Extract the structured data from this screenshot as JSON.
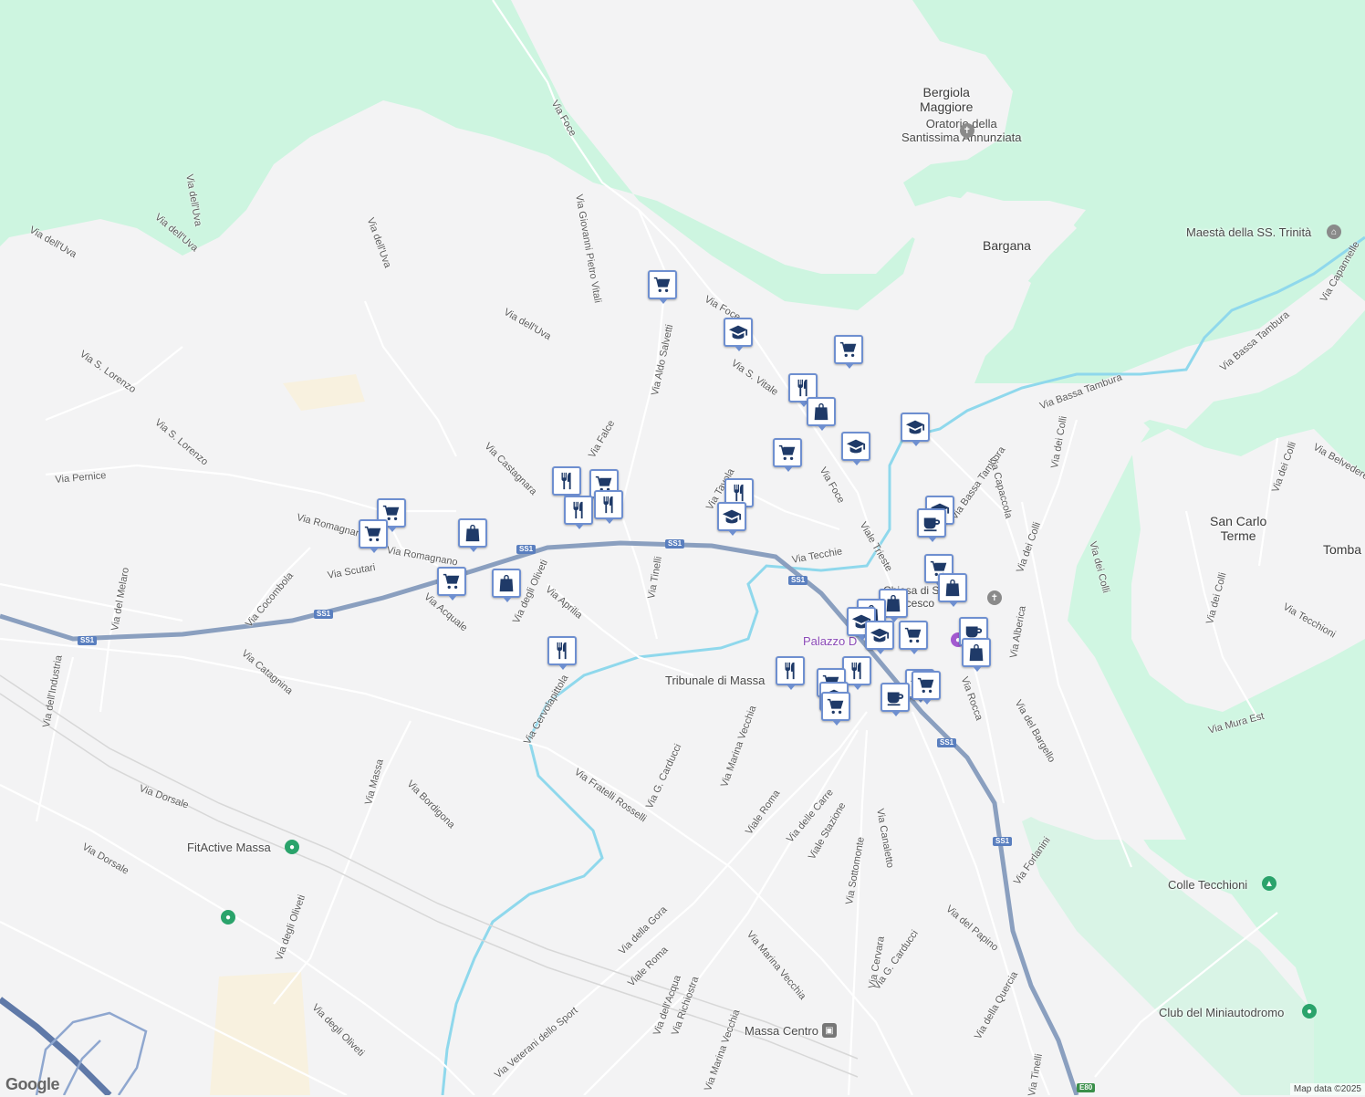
{
  "places": {
    "bergiola": "Bergiola\nMaggiore",
    "bargana": "Bargana",
    "san_carlo": "San Carlo\nTerme",
    "tomba": "Tomba",
    "palazzo": "Palazzo D"
  },
  "pois": {
    "oratorio": "Oratorio della\nSantissima Annunziata",
    "maesta": "Maestà della SS. Trinità",
    "fitactive": "FitActive Massa",
    "colle": "Colle Tecchioni",
    "club": "Club del Miniautodromo",
    "tribunale": "Tribunale di Massa",
    "massa_centro": "Massa Centro",
    "chiesa": "Chiesa di San Francesco"
  },
  "streets": [
    {
      "name": "Via Foce"
    },
    {
      "name": "Via Giovanni Pietro Vitali"
    },
    {
      "name": "Via dell'Uva"
    },
    {
      "name": "Via dell'Uva"
    },
    {
      "name": "Via dell'Uva"
    },
    {
      "name": "Via dell'Uva"
    },
    {
      "name": "Via dell'Uva"
    },
    {
      "name": "Via Aldo Salvetti"
    },
    {
      "name": "Via Foce"
    },
    {
      "name": "Via S. Vitale"
    },
    {
      "name": "Via S. Lorenzo"
    },
    {
      "name": "Via S. Lorenzo"
    },
    {
      "name": "Via Castagnara"
    },
    {
      "name": "Via Falce"
    },
    {
      "name": "Via Pernice"
    },
    {
      "name": "Via Romagnano"
    },
    {
      "name": "Via Romagnano"
    },
    {
      "name": "Via Scutari"
    },
    {
      "name": "Via Cocombola"
    },
    {
      "name": "Via del Melaro"
    },
    {
      "name": "Via dell'Industria"
    },
    {
      "name": "Via Catagnina"
    },
    {
      "name": "Via Acquale"
    },
    {
      "name": "Via degli Oliveti"
    },
    {
      "name": "Via Aprilia"
    },
    {
      "name": "Via Tinelli"
    },
    {
      "name": "Via Tavola"
    },
    {
      "name": "Via Tecchie"
    },
    {
      "name": "Via Foce"
    },
    {
      "name": "Viale Trieste"
    },
    {
      "name": "Via Bassa Tambura"
    },
    {
      "name": "Via Bassa Tambura"
    },
    {
      "name": "Via Bassa Tambura"
    },
    {
      "name": "Via Capannelle"
    },
    {
      "name": "Via Capaccola"
    },
    {
      "name": "Via dei Colli"
    },
    {
      "name": "Via dei Colli"
    },
    {
      "name": "Via dei Colli"
    },
    {
      "name": "Via dei Colli"
    },
    {
      "name": "Via dei Colli"
    },
    {
      "name": "Via Belvedere"
    },
    {
      "name": "Via Tecchioni"
    },
    {
      "name": "Via Mura Est"
    },
    {
      "name": "Via Alberica"
    },
    {
      "name": "Via Rocca"
    },
    {
      "name": "Via del Bargello"
    },
    {
      "name": "Via Forlanini"
    },
    {
      "name": "Via del Papino"
    },
    {
      "name": "Via della Quercia"
    },
    {
      "name": "Via Tinelli"
    },
    {
      "name": "Via Cervolapittola"
    },
    {
      "name": "Via G. Carducci"
    },
    {
      "name": "Via Fratelli Rosselli"
    },
    {
      "name": "Via Marina Vecchia"
    },
    {
      "name": "Viale Roma"
    },
    {
      "name": "Via delle Carre"
    },
    {
      "name": "Viale Stazione"
    },
    {
      "name": "Via Sottomonte"
    },
    {
      "name": "Via Canaletto"
    },
    {
      "name": "Via Cervara"
    },
    {
      "name": "Via G. Carducci"
    },
    {
      "name": "Via Marina Vecchia"
    },
    {
      "name": "Via della Gora"
    },
    {
      "name": "Viale Roma"
    },
    {
      "name": "Via dell'Acqua"
    },
    {
      "name": "Via Richiostra"
    },
    {
      "name": "Via Marina Vecchia"
    },
    {
      "name": "Via Veterani dello Sport"
    },
    {
      "name": "Via Bordigona"
    },
    {
      "name": "Via Dorsale"
    },
    {
      "name": "Via Dorsale"
    },
    {
      "name": "Via degli Oliveti"
    },
    {
      "name": "Via degli Oliveti"
    },
    {
      "name": "Via Massa"
    }
  ],
  "highway_shields": [
    "SS1",
    "SS1",
    "SS1",
    "SS1",
    "SS1",
    "SS1",
    "SS1",
    "E80"
  ],
  "markers": [
    {
      "type": "cart"
    },
    {
      "type": "school"
    },
    {
      "type": "cart"
    },
    {
      "type": "food"
    },
    {
      "type": "shop"
    },
    {
      "type": "cart"
    },
    {
      "type": "school"
    },
    {
      "type": "school"
    },
    {
      "type": "food"
    },
    {
      "type": "cart"
    },
    {
      "type": "food"
    },
    {
      "type": "food"
    },
    {
      "type": "cart"
    },
    {
      "type": "cart"
    },
    {
      "type": "shop"
    },
    {
      "type": "cart"
    },
    {
      "type": "shop"
    },
    {
      "type": "food"
    },
    {
      "type": "food"
    },
    {
      "type": "school"
    },
    {
      "type": "school"
    },
    {
      "type": "cafe"
    },
    {
      "type": "cart"
    },
    {
      "type": "shop"
    },
    {
      "type": "shop"
    },
    {
      "type": "shop"
    },
    {
      "type": "school"
    },
    {
      "type": "school"
    },
    {
      "type": "cart"
    },
    {
      "type": "cafe"
    },
    {
      "type": "shop"
    },
    {
      "type": "food"
    },
    {
      "type": "food"
    },
    {
      "type": "cart"
    },
    {
      "type": "school"
    },
    {
      "type": "school"
    },
    {
      "type": "cart"
    },
    {
      "type": "cafe"
    },
    {
      "type": "cart"
    }
  ],
  "attribution": "Map data ©2025",
  "logo": "Google",
  "colors": {
    "park": "#cdf5e0",
    "river": "#8fd8ec",
    "highway": "#8a9fbf",
    "marker_border": "#6e8fd0",
    "marker_icon": "#1f3a68"
  }
}
